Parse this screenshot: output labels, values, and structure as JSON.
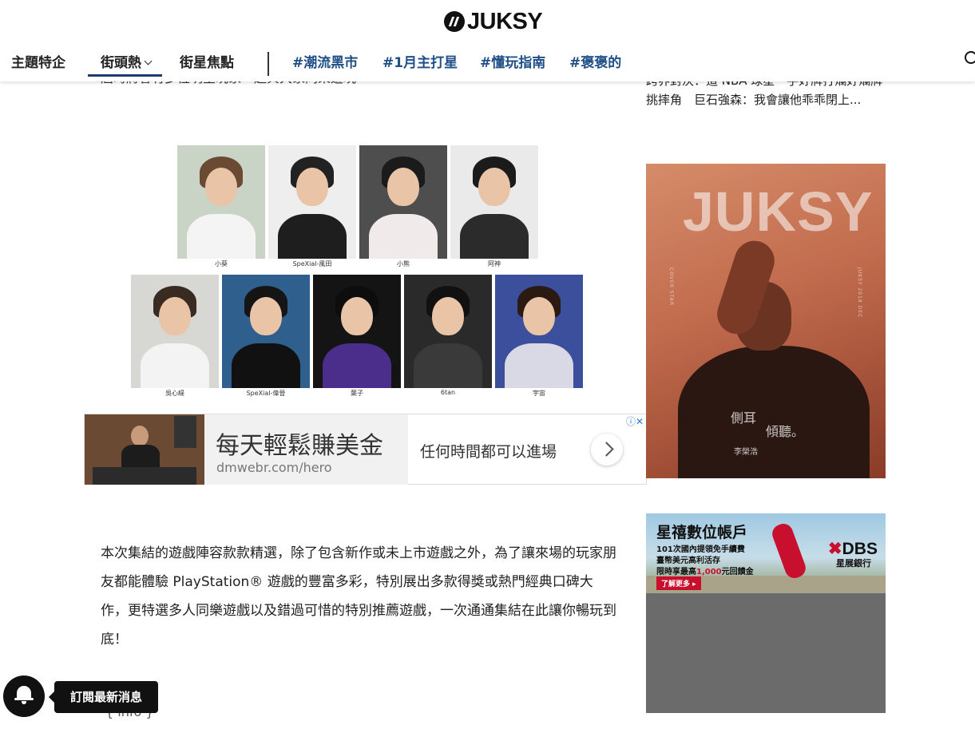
{
  "header": {
    "logo_text": "JUKSY",
    "nav": [
      {
        "label": "主題特企"
      },
      {
        "label": "街頭熱"
      },
      {
        "label": "街星焦點"
      }
    ],
    "tags": [
      {
        "label": "#潮流黑市"
      },
      {
        "label": "#1月主打星"
      },
      {
        "label": "#懂玩指南"
      },
      {
        "label": "#褒褒的"
      }
    ]
  },
  "article": {
    "cut_text": "屆時將會有多位明星玩家一起與大家同樂遊玩",
    "cast": [
      {
        "name": "小葵"
      },
      {
        "name": "SpeXial-風田"
      },
      {
        "name": "小熊"
      },
      {
        "name": "阿神"
      },
      {
        "name": "吳心緹"
      },
      {
        "name": "SpeXial-偉晉"
      },
      {
        "name": "葉子"
      },
      {
        "name": "6tan"
      },
      {
        "name": "宇宙"
      }
    ],
    "paragraph": "本次集結的遊戲陣容款款精選，除了包含新作或未上市遊戲之外，為了讓來場的玩家朋友都能體驗 PlayStation® 遊戲的豐富多彩，特別展出多款得獎或熱門經典口碑大作，更特選多人同樂遊戲以及錯過可惜的特別推薦遊戲，一次通通集結在此讓你暢玩到底！",
    "info_label": "{ info }"
  },
  "ad": {
    "headline": "每天輕鬆賺美金",
    "url": "dmwebr.com/hero",
    "tagline": "任何時間都可以進場",
    "choices": "ⓘ✕"
  },
  "sidebar": {
    "text_line1": "跨界對決：這 NBA 球星一手好牌打爛好爛牌",
    "text_line2": "挑摔角　巨石強森：我會讓他乖乖閉上...",
    "cover": {
      "title": "JUKSY",
      "tag1": "側耳",
      "tag2": "傾聽。",
      "name": "李榮浩",
      "side_left": "COVER STAR",
      "side_right": "JUKSY 2018 DEC"
    },
    "dbs": {
      "title": "星禧數位帳戶",
      "line1": "101次國內提領免手續費",
      "line2": "臺幣美元高利活存",
      "line3_pre": "限時享最高",
      "line3_hl": "1,000",
      "line3_post": "元回饋金",
      "button": "了解更多 ▸",
      "logo_x": "✖",
      "logo": "DBS",
      "logo_sub": "星展銀行"
    }
  },
  "subscribe": {
    "label": "訂閱最新消息"
  },
  "colors": {
    "nav_active": "#1f3a6e",
    "tag_blue": "#1f4f86",
    "dbs_red": "#c8102e"
  }
}
